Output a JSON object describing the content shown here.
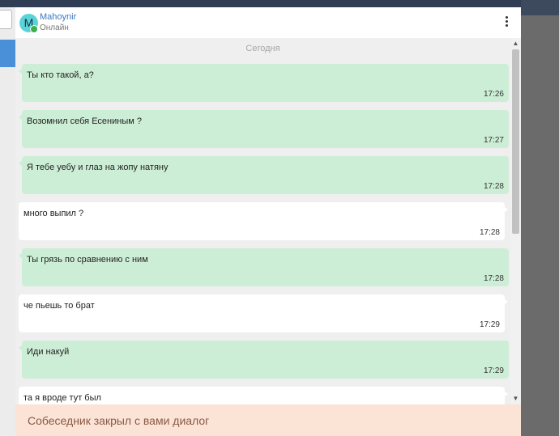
{
  "contact": {
    "avatar_letter": "M",
    "name": "Mahoynir",
    "status": "Онлайн",
    "menu_icon": "more-vertical-icon"
  },
  "date_separator": "Сегодня",
  "messages": [
    {
      "dir": "in",
      "text": "Ты кто такой, а?",
      "time": "17:26"
    },
    {
      "dir": "in",
      "text": "Возомнил себя Есениным ?",
      "time": "17:27"
    },
    {
      "dir": "in",
      "text": "Я тебе уебу и глаз на жопу натяну",
      "time": "17:28"
    },
    {
      "dir": "out",
      "text": "много выпил ?",
      "time": "17:28"
    },
    {
      "dir": "in",
      "text": "Ты грязь по сравнению  с ним",
      "time": "17:28"
    },
    {
      "dir": "out",
      "text": "че пьешь то брат",
      "time": "17:29"
    },
    {
      "dir": "in",
      "text": "Иди накуй",
      "time": "17:29"
    },
    {
      "dir": "out",
      "text": "та я вроде тут был",
      "time": ""
    }
  ],
  "scroll": {
    "up": "^",
    "down": "v"
  },
  "closed_notice": "Собеседник закрыл с вами диалог",
  "colors": {
    "incoming_bubble": "#cdeed6",
    "outgoing_bubble": "#ffffff",
    "banner": "#fbe3d6",
    "online": "#3cb04a",
    "name_link": "#3a78c2"
  }
}
